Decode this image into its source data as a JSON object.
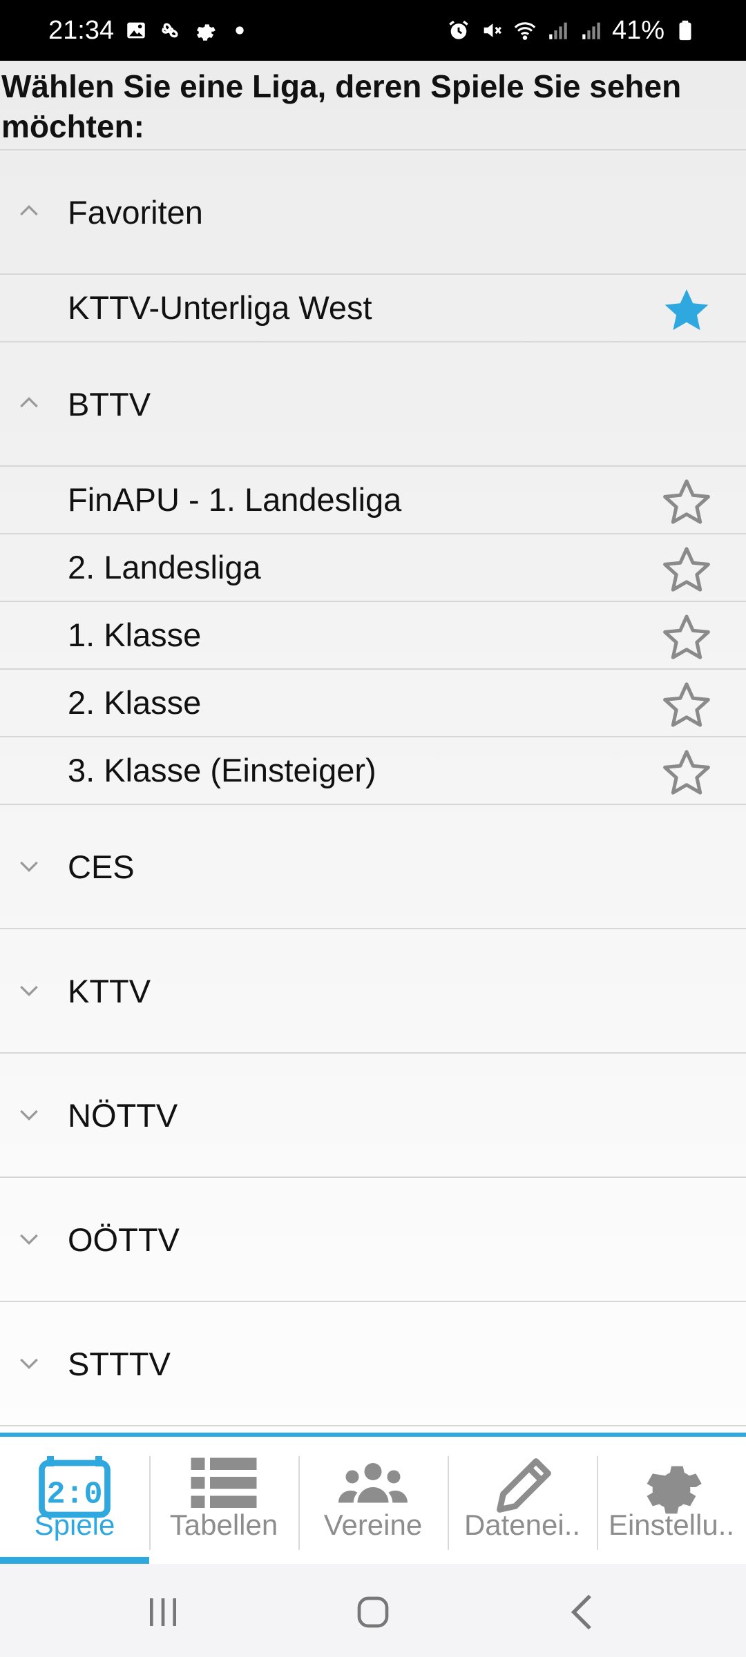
{
  "status_bar": {
    "time": "21:34",
    "battery": "41%",
    "icons_left": [
      "gallery-icon",
      "fan-icon",
      "settings-gear-icon",
      "dot-icon"
    ],
    "icons_right": [
      "alarm-icon",
      "mute-icon",
      "wifi-icon",
      "signal-icon",
      "signal-icon",
      "battery-icon"
    ]
  },
  "prompt": "Wählen Sie eine Liga, deren Spiele Sie sehen möchten:",
  "groups": [
    {
      "label": "Favoriten",
      "expanded": true,
      "leagues": [
        {
          "label": "KTTV-Unterliga West",
          "favorite": true
        }
      ]
    },
    {
      "label": "BTTV",
      "expanded": true,
      "leagues": [
        {
          "label": "FinAPU - 1. Landesliga",
          "favorite": false
        },
        {
          "label": "2. Landesliga",
          "favorite": false
        },
        {
          "label": "1. Klasse",
          "favorite": false
        },
        {
          "label": "2. Klasse",
          "favorite": false
        },
        {
          "label": "3. Klasse (Einsteiger)",
          "favorite": false
        }
      ]
    },
    {
      "label": "CES",
      "expanded": false,
      "leagues": []
    },
    {
      "label": "KTTV",
      "expanded": false,
      "leagues": []
    },
    {
      "label": "NÖTTV",
      "expanded": false,
      "leagues": []
    },
    {
      "label": "OÖTTV",
      "expanded": false,
      "leagues": []
    },
    {
      "label": "STTTV",
      "expanded": false,
      "leagues": []
    }
  ],
  "tabs": [
    {
      "label": "Spiele",
      "icon": "scoreboard-icon",
      "active": true
    },
    {
      "label": "Tabellen",
      "icon": "list-icon",
      "active": false
    },
    {
      "label": "Vereine",
      "icon": "group-icon",
      "active": false
    },
    {
      "label": "Datenei..",
      "icon": "pencil-icon",
      "active": false
    },
    {
      "label": "Einstellu..",
      "icon": "gear-icon",
      "active": false
    }
  ],
  "colors": {
    "accent": "#2fa8df",
    "star_favorite": "#2fa8df",
    "star_empty": "#8a8a8a",
    "tab_inactive": "#8d8d8d",
    "divider": "#d7d7d7"
  }
}
